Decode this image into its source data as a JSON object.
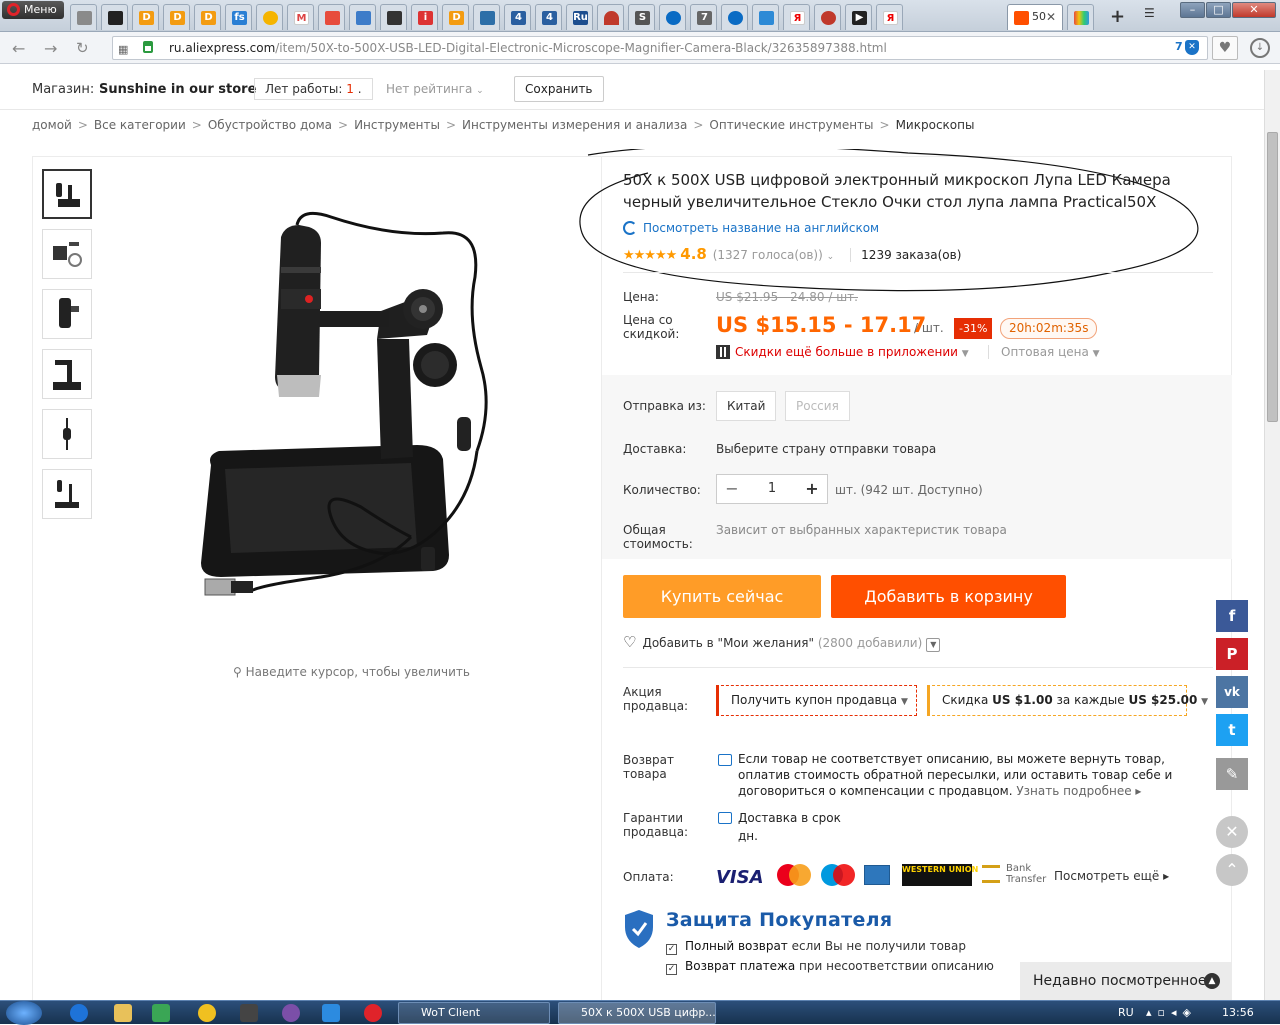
{
  "browser": {
    "menu_label": "Меню",
    "active_tab_label": "50",
    "new_tab_label": "+",
    "url_domain": "ru.aliexpress.com",
    "url_path": "/item/50X-to-500X-USB-LED-Digital-Electronic-Microscope-Magnifier-Camera-Black/32635897388.html",
    "extension_badge": "7"
  },
  "store": {
    "label": "Магазин:",
    "name": "Sunshine in our store",
    "years_label": "Лет работы:",
    "years_value": "1",
    "rating_label": "Нет рейтинга",
    "save_label": "Сохранить"
  },
  "breadcrumb": [
    "домой",
    "Все категории",
    "Обустройство дома",
    "Инструменты",
    "Инструменты измерения и анализа",
    "Оптические инструменты",
    "Микроскопы"
  ],
  "gallery": {
    "zoom_hint": "Наведите курсор, чтобы увеличить"
  },
  "product": {
    "title": "50X к 500X USB цифровой электронный микроскоп Лупа LED Камера черный увеличительное Стекло Очки стол лупа лампа Practical50X",
    "view_english": "Посмотреть название на английском",
    "stars": "★★★★★",
    "rating": "4.8",
    "votes": "(1327 голоса(ов))",
    "orders": "1239 заказа(ов)",
    "price_label": "Цена:",
    "old_price": "US $21.95 - 24.80 / шт.",
    "discount_price_label": "Цена со скидкой:",
    "price": "US $15.15 - 17.17",
    "per_unit": "/ шт.",
    "discount": "-31%",
    "timer": "20h:02m:35s",
    "app_discount": "Скидки ещё больше в приложении",
    "wholesale": "Оптовая цена",
    "ship_from_label": "Отправка из:",
    "ship_from_options": [
      "Китай",
      "Россия"
    ],
    "delivery_label": "Доставка:",
    "delivery_text": "Выберите страну отправки товара",
    "quantity_label": "Количество:",
    "quantity_value": "1",
    "quantity_available": "шт. (942 шт. Доступно)",
    "total_label": "Общая стоимость:",
    "total_text": "Зависит от выбранных характеристик товара",
    "buy_now": "Купить сейчас",
    "add_to_cart": "Добавить в корзину",
    "wishlist": "Добавить в \"Мои желания\"",
    "wishlist_count": "(2800 добавили)",
    "seller_promo_label": "Акция продавца:",
    "coupon": "Получить купон продавца",
    "store_discount_prefix": "Скидка",
    "store_discount_amount": "US $1.00",
    "store_discount_mid": "за каждые",
    "store_discount_threshold": "US $25.00",
    "return_label": "Возврат товара",
    "return_text": "Если товар не соответствует описанию, вы можете вернуть товар, оплатив стоимость обратной пересылки, или оставить товар себе и договориться о компенсации с продавцом.",
    "return_more": "Узнать подробнее",
    "guarantee_label": "Гарантии продавца:",
    "guarantee_text": "Доставка в срок дн.",
    "payment_label": "Оплата:",
    "payment_methods": [
      "VISA",
      "MasterCard",
      "Maestro",
      "AMEX",
      "WESTERN UNION",
      "Bank Transfer"
    ],
    "more_payments": "Посмотреть ещё",
    "buyer_protection_title": "Защита Покупателя",
    "bp_item1_bold": "Полный возврат",
    "bp_item1_rest": "если Вы не получили товар",
    "bp_item2_bold": "Возврат платежа",
    "bp_item2_rest": "при несоответствии описанию"
  },
  "social": [
    "facebook",
    "pinterest",
    "vk",
    "twitter",
    "edit"
  ],
  "recently_viewed": "Недавно посмотренное",
  "taskbar": {
    "task1": "WoT Client",
    "task2": "50X к 500X USB цифр...",
    "lang": "RU",
    "clock": "13:56"
  },
  "colors": {
    "accent_orange": "#ff6600",
    "buy_now": "#ff9c27",
    "add_to_cart": "#ff4f00",
    "discount_red": "#e62e04",
    "link_blue": "#1a73c7"
  }
}
